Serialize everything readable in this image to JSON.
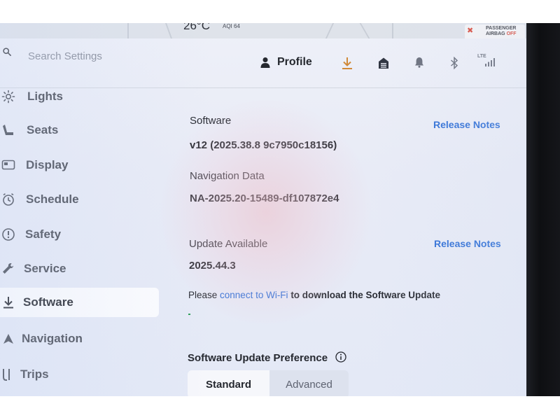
{
  "status_bar": {
    "temperature": "26°C",
    "aqi": "AQI 64",
    "airbag_line1": "PASSENGER",
    "airbag_line2": "AIRBAG",
    "airbag_state": "OFF"
  },
  "header": {
    "search_placeholder": "Search Settings",
    "profile_label": "Profile",
    "signal_label": "LTE",
    "icons": [
      "download-icon",
      "garage-icon",
      "bell-icon",
      "bluetooth-icon",
      "lte-signal-icon"
    ]
  },
  "sidebar": {
    "items": [
      {
        "label": "Lights",
        "icon": "lightbulb-icon",
        "active": false
      },
      {
        "label": "Seats",
        "icon": "seat-icon",
        "active": false
      },
      {
        "label": "Display",
        "icon": "display-icon",
        "active": false
      },
      {
        "label": "Schedule",
        "icon": "clock-icon",
        "active": false
      },
      {
        "label": "Safety",
        "icon": "alert-icon",
        "active": false
      },
      {
        "label": "Service",
        "icon": "wrench-icon",
        "active": false
      },
      {
        "label": "Software",
        "icon": "download-icon",
        "active": true
      },
      {
        "label": "Navigation",
        "icon": "navigation-arrow-icon",
        "active": false
      },
      {
        "label": "Trips",
        "icon": "trips-icon",
        "active": false
      }
    ]
  },
  "software": {
    "title": "Software",
    "version": "v12 (2025.38.8 9c7950c18156)",
    "release_notes": "Release Notes"
  },
  "navigation_data": {
    "title": "Navigation Data",
    "version": "NA-2025.20-15489-df107872e4"
  },
  "update": {
    "title": "Update Available",
    "version": "2025.44.3",
    "release_notes": "Release Notes",
    "message_prefix": "Please ",
    "message_link": "connect to Wi-Fi",
    "message_suffix": " to download the Software Update",
    "progress": 0.01
  },
  "preference": {
    "title": "Software Update Preference",
    "options": [
      "Standard",
      "Advanced"
    ],
    "selected": "Standard"
  },
  "colors": {
    "accent": "#2f6fd6",
    "download_icon": "#d08a3a",
    "progress": "#2fa05a",
    "airbag_warning": "#d94a3a"
  }
}
